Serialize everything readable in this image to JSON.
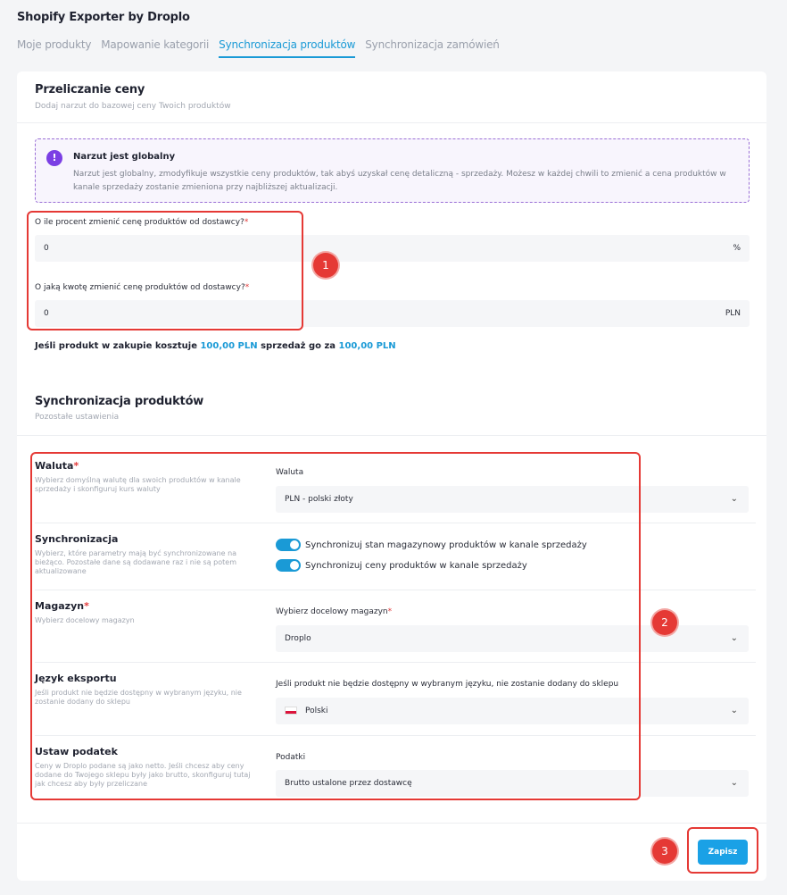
{
  "app": {
    "title": "Shopify Exporter by Droplo"
  },
  "tabs": [
    {
      "label": "Moje produkty",
      "active": false
    },
    {
      "label": "Mapowanie kategorii",
      "active": false
    },
    {
      "label": "Synchronizacja produktów",
      "active": true
    },
    {
      "label": "Synchronizacja zamówień",
      "active": false
    }
  ],
  "price": {
    "title": "Przeliczanie ceny",
    "subtitle": "Dodaj narzut do bazowej ceny Twoich produktów",
    "notice": {
      "icon": "exclamation-icon",
      "title": "Narzut jest globalny",
      "text": "Narzut jest globalny, zmodyfikuje wszystkie ceny produktów, tak abyś uzyskał cenę detaliczną - sprzedaży. Możesz w każdej chwili to zmienić a cena produktów w kanale sprzedaży zostanie zmieniona przy najbliższej aktualizacji."
    },
    "percent": {
      "label": "O ile procent zmienić cenę produktów od dostawcy?",
      "required": "*",
      "value": "0",
      "suffix": "%"
    },
    "amount": {
      "label": "O jaką kwotę zmienić cenę produktów od dostawcy?",
      "required": "*",
      "value": "0",
      "suffix": "PLN"
    },
    "summary": {
      "part1": "Jeśli produkt w zakupie kosztuje ",
      "buy_price": "100,00 PLN",
      "part2": " sprzedaż go za ",
      "sell_price": "100,00 PLN"
    }
  },
  "sync": {
    "title": "Synchronizacja produktów",
    "subtitle": "Pozostałe ustawienia",
    "currency": {
      "title": "Waluta",
      "required": "*",
      "desc": "Wybierz domyślną walutę dla swoich produktów w kanale sprzedaży i skonfiguruj kurs waluty",
      "field_label": "Waluta",
      "value": "PLN - polski złoty"
    },
    "synchronization": {
      "title": "Synchronizacja",
      "desc": "Wybierz, które parametry mają być synchronizowane na bieżąco. Pozostałe dane są dodawane raz i nie są potem aktualizowane",
      "toggle1": {
        "label": "Synchronizuj stan magazynowy produktów w kanale sprzedaży",
        "on": true
      },
      "toggle2": {
        "label": "Synchronizuj ceny produktów w kanale sprzedaży",
        "on": true
      }
    },
    "warehouse": {
      "title": "Magazyn",
      "required": "*",
      "desc": "Wybierz docelowy magazyn",
      "field_label": "Wybierz docelowy magazyn",
      "field_required": "*",
      "value": "Droplo"
    },
    "language": {
      "title": "Język eksportu",
      "desc": "Jeśli produkt nie będzie dostępny w wybranym języku, nie zostanie dodany do sklepu",
      "field_label": "Jeśli produkt nie będzie dostępny w wybranym języku, nie zostanie dodany do sklepu",
      "value": "Polski",
      "flag": "poland-flag-icon"
    },
    "tax": {
      "title": "Ustaw podatek",
      "desc": "Ceny w Droplo podane są jako netto. Jeśli chcesz aby ceny dodane do Twojego sklepu były jako brutto, skonfiguruj tutaj jak chcesz aby były przeliczane",
      "field_label": "Podatki",
      "value": "Brutto ustalone przez dostawcę"
    }
  },
  "save": {
    "label": "Zapisz"
  },
  "annotations": {
    "m1": "1",
    "m2": "2",
    "m3": "3"
  },
  "colors": {
    "accent": "#1a9ad6",
    "annotation": "#e53935",
    "notice_icon": "#7b3fe4"
  }
}
